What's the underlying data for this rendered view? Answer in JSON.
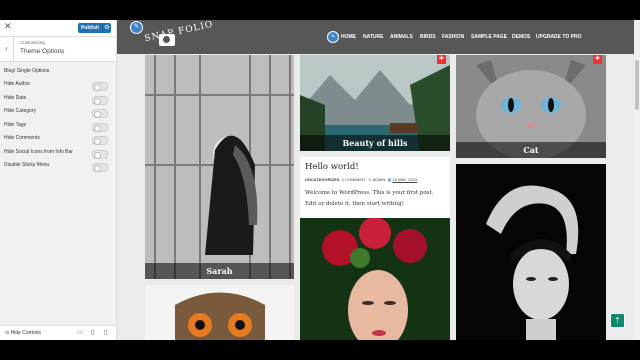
{
  "customizer": {
    "close_icon": "✕",
    "publish_label": "Publish",
    "settings_icon": "⚙",
    "back_icon": "‹",
    "breadcrumb": "Customizing",
    "panel_title": "Theme Options",
    "section_title": "Blog/ Single Options",
    "options": [
      {
        "label": "Hide Author",
        "checked": false
      },
      {
        "label": "Hide Date",
        "checked": false
      },
      {
        "label": "Hide Category",
        "checked": false
      },
      {
        "label": "Hide Tags",
        "checked": false
      },
      {
        "label": "Hide Comments",
        "checked": false
      },
      {
        "label": "Hide Social Icons from Info Bar",
        "checked": false
      },
      {
        "label": "Disable Sticky Menu",
        "checked": false
      }
    ],
    "hide_controls_label": "Hide Controls",
    "devices": [
      "desktop-icon",
      "tablet-icon",
      "mobile-icon"
    ]
  },
  "site": {
    "logo_text": "SNAP FOLIO",
    "nav": [
      "HOME",
      "NATURE",
      "ANIMALS",
      "BIRDS",
      "FASHION",
      "SAMPLE PAGE",
      "DEMOS",
      "UPGRADE TO PRO"
    ],
    "cards": {
      "sarah_caption": "Sarah",
      "beauty_caption": "Beauty of hills",
      "cat_caption": "Cat"
    },
    "post": {
      "title": "Hello world!",
      "category": "UNCATEGORIZED",
      "comments": "1 COMMENT",
      "author": "ADMIN",
      "date": "16 MAY, 2023",
      "excerpt": "Welcome to WordPress. This is your first post. Edit or delete it, then start writing!"
    },
    "scroll_top_icon": "⇡"
  },
  "colors": {
    "publish_blue": "#2271b1",
    "header_gray": "#575757",
    "pin_red": "#e33333",
    "scroll_green": "#0a8a6a"
  }
}
